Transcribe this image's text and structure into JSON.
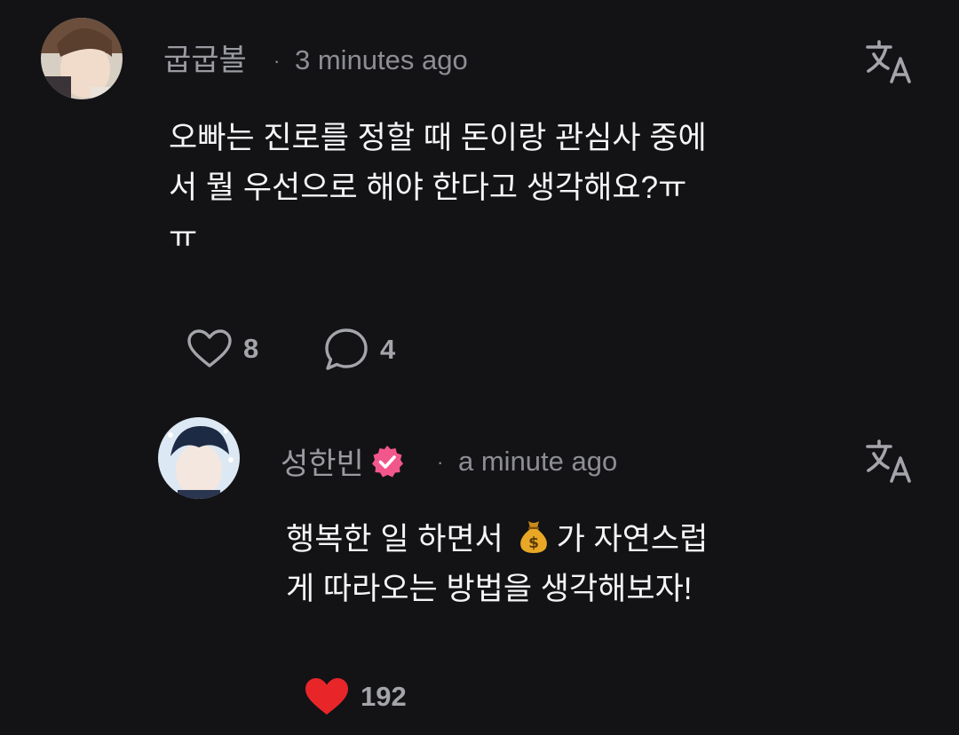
{
  "comment": {
    "username": "굽굽볼",
    "separator": "·",
    "timestamp": "3 minutes ago",
    "text": "오빠는 진로를 정할 때 돈이랑 관심사 중에\n서 뭘 우선으로 해야 한다고 생각해요?ㅠ\nㅠ",
    "likes": "8",
    "replies": "4",
    "icons": {
      "translate": "translate-icon",
      "like": "heart-outline-icon",
      "reply": "speech-bubble-icon"
    }
  },
  "reply": {
    "username": "성한빈",
    "separator": "·",
    "timestamp": "a minute ago",
    "text_part1": "행복한 일 하면서 ",
    "text_part2": "가 자연스럽\n게 따라오는 방법을 생각해보자!",
    "likes": "192",
    "verified": true,
    "icons": {
      "translate": "translate-icon",
      "like": "heart-filled-icon",
      "emoji": "money-bag-emoji",
      "badge": "verified-badge-icon"
    }
  },
  "colors": {
    "background": "#131316",
    "username": "#9a9ba1",
    "meta": "#8d8e94",
    "text": "#f5f5f7",
    "liked_heart": "#e8262a",
    "verified_badge": "#f2578c"
  }
}
